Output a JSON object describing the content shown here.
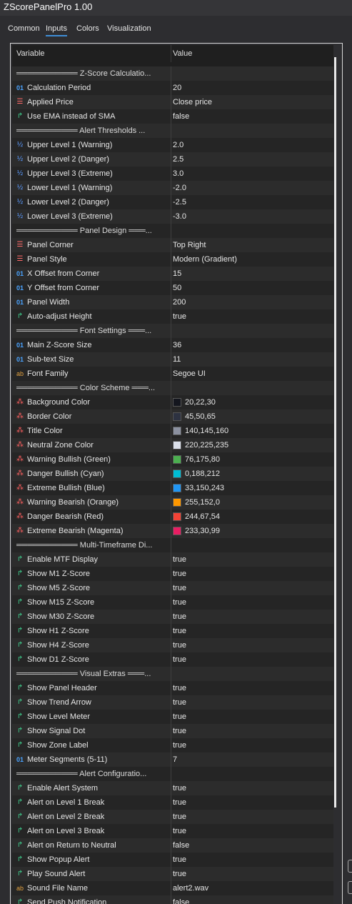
{
  "window": {
    "title": "ZScorePanelPro 1.00"
  },
  "tabs": [
    {
      "label": "Common",
      "active": false
    },
    {
      "label": "Inputs",
      "active": true
    },
    {
      "label": "Colors",
      "active": false
    },
    {
      "label": "Visualization",
      "active": false
    }
  ],
  "table": {
    "col_variable": "Variable",
    "col_value": "Value",
    "rows": [
      {
        "type": "section",
        "name": "═══════════ Z-Score Calculatio..."
      },
      {
        "type": "int",
        "name": "Calculation Period",
        "value": "20"
      },
      {
        "type": "enum",
        "name": "Applied Price",
        "value": "Close price"
      },
      {
        "type": "bool",
        "name": "Use EMA instead of SMA",
        "value": "false"
      },
      {
        "type": "section",
        "name": "═══════════ Alert Thresholds ..."
      },
      {
        "type": "double",
        "name": "Upper Level 1 (Warning)",
        "value": "2.0"
      },
      {
        "type": "double",
        "name": "Upper Level 2 (Danger)",
        "value": "2.5"
      },
      {
        "type": "double",
        "name": "Upper Level 3 (Extreme)",
        "value": "3.0"
      },
      {
        "type": "double",
        "name": "Lower Level 1 (Warning)",
        "value": "-2.0"
      },
      {
        "type": "double",
        "name": "Lower Level 2 (Danger)",
        "value": "-2.5"
      },
      {
        "type": "double",
        "name": "Lower Level 3 (Extreme)",
        "value": "-3.0"
      },
      {
        "type": "section",
        "name": "═══════════ Panel Design ═══..."
      },
      {
        "type": "enum",
        "name": "Panel Corner",
        "value": "Top Right"
      },
      {
        "type": "enum",
        "name": "Panel Style",
        "value": "Modern (Gradient)"
      },
      {
        "type": "int",
        "name": "X Offset from Corner",
        "value": "15"
      },
      {
        "type": "int",
        "name": "Y Offset from Corner",
        "value": "50"
      },
      {
        "type": "int",
        "name": "Panel Width",
        "value": "200"
      },
      {
        "type": "bool",
        "name": "Auto-adjust Height",
        "value": "true"
      },
      {
        "type": "section",
        "name": "═══════════ Font Settings ═══..."
      },
      {
        "type": "int",
        "name": "Main Z-Score Size",
        "value": "36"
      },
      {
        "type": "int",
        "name": "Sub-text Size",
        "value": "11"
      },
      {
        "type": "string",
        "name": "Font Family",
        "value": "Segoe UI"
      },
      {
        "type": "section",
        "name": "═══════════ Color Scheme ═══..."
      },
      {
        "type": "color",
        "name": "Background Color",
        "value": "20,22,30",
        "swatch": "#14161e"
      },
      {
        "type": "color",
        "name": "Border Color",
        "value": "45,50,65",
        "swatch": "#2d3241"
      },
      {
        "type": "color",
        "name": "Title Color",
        "value": "140,145,160",
        "swatch": "#8c91a0"
      },
      {
        "type": "color",
        "name": "Neutral Zone Color",
        "value": "220,225,235",
        "swatch": "#dce1eb"
      },
      {
        "type": "color",
        "name": "Warning Bullish (Green)",
        "value": "76,175,80",
        "swatch": "#4caf50"
      },
      {
        "type": "color",
        "name": "Danger Bullish (Cyan)",
        "value": "0,188,212",
        "swatch": "#00bcd4"
      },
      {
        "type": "color",
        "name": "Extreme Bullish (Blue)",
        "value": "33,150,243",
        "swatch": "#2196f3"
      },
      {
        "type": "color",
        "name": "Warning Bearish (Orange)",
        "value": "255,152,0",
        "swatch": "#ff9800"
      },
      {
        "type": "color",
        "name": "Danger Bearish (Red)",
        "value": "244,67,54",
        "swatch": "#f44336"
      },
      {
        "type": "color",
        "name": "Extreme Bearish (Magenta)",
        "value": "233,30,99",
        "swatch": "#e91e63"
      },
      {
        "type": "section",
        "name": "═══════════ Multi-Timeframe Di..."
      },
      {
        "type": "bool",
        "name": "Enable MTF Display",
        "value": "true"
      },
      {
        "type": "bool",
        "name": "Show M1 Z-Score",
        "value": "true"
      },
      {
        "type": "bool",
        "name": "Show M5 Z-Score",
        "value": "true"
      },
      {
        "type": "bool",
        "name": "Show M15 Z-Score",
        "value": "true"
      },
      {
        "type": "bool",
        "name": "Show M30 Z-Score",
        "value": "true"
      },
      {
        "type": "bool",
        "name": "Show H1 Z-Score",
        "value": "true"
      },
      {
        "type": "bool",
        "name": "Show H4 Z-Score",
        "value": "true"
      },
      {
        "type": "bool",
        "name": "Show D1 Z-Score",
        "value": "true"
      },
      {
        "type": "section",
        "name": "═══════════ Visual Extras ═══..."
      },
      {
        "type": "bool",
        "name": "Show Panel Header",
        "value": "true"
      },
      {
        "type": "bool",
        "name": "Show Trend Arrow",
        "value": "true"
      },
      {
        "type": "bool",
        "name": "Show Level Meter",
        "value": "true"
      },
      {
        "type": "bool",
        "name": "Show Signal Dot",
        "value": "true"
      },
      {
        "type": "bool",
        "name": "Show Zone Label",
        "value": "true"
      },
      {
        "type": "int",
        "name": "Meter Segments (5-11)",
        "value": "7"
      },
      {
        "type": "section",
        "name": "═══════════ Alert Configuratio..."
      },
      {
        "type": "bool",
        "name": "Enable Alert System",
        "value": "true"
      },
      {
        "type": "bool",
        "name": "Alert on Level 1 Break",
        "value": "true"
      },
      {
        "type": "bool",
        "name": "Alert on Level 2 Break",
        "value": "true"
      },
      {
        "type": "bool",
        "name": "Alert on Level 3 Break",
        "value": "true"
      },
      {
        "type": "bool",
        "name": "Alert on Return to Neutral",
        "value": "false"
      },
      {
        "type": "bool",
        "name": "Show Popup Alert",
        "value": "true"
      },
      {
        "type": "bool",
        "name": "Play Sound Alert",
        "value": "true"
      },
      {
        "type": "string",
        "name": "Sound File Name",
        "value": "alert2.wav"
      },
      {
        "type": "bool",
        "name": "Send Push Notification",
        "value": "false"
      }
    ]
  },
  "icons": {
    "int": "01",
    "double": "½",
    "bool": "↱",
    "enum": "☰",
    "string": "ab",
    "color": "⁂",
    "section": ""
  }
}
